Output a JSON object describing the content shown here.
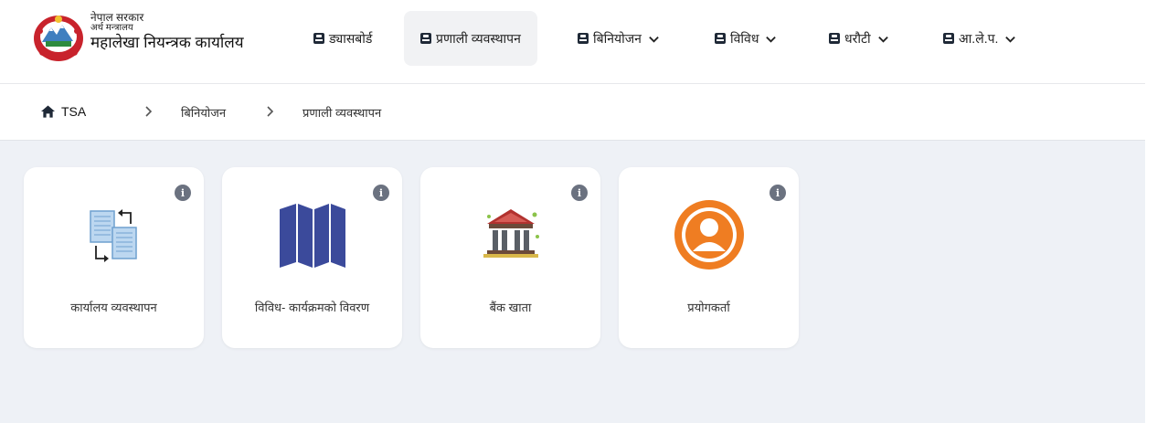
{
  "header": {
    "org_line1": "नेपाल सरकार",
    "org_line2": "अर्थ मन्त्रालय",
    "org_line3": "महालेखा नियन्त्रक कार्यालय",
    "nav": [
      {
        "label": "ड्यासबोर्ड",
        "dropdown": false,
        "active": false
      },
      {
        "label": "प्रणाली व्यवस्थापन",
        "dropdown": false,
        "active": true
      },
      {
        "label": "बिनियोजन",
        "dropdown": true,
        "active": false
      },
      {
        "label": "विविध",
        "dropdown": true,
        "active": false
      },
      {
        "label": "धरौटी",
        "dropdown": true,
        "active": false
      },
      {
        "label": "आ.ले.प.",
        "dropdown": true,
        "active": false
      }
    ]
  },
  "breadcrumb": {
    "home": "TSA",
    "items": [
      "बिनियोजन",
      "प्रणाली व्यवस्थापन"
    ]
  },
  "cards": [
    {
      "label": "कार्यालय व्यवस्थापन",
      "icon": "document-transfer-icon"
    },
    {
      "label": "विविध- कार्यक्रमको विवरण",
      "icon": "map-icon"
    },
    {
      "label": "बैंक खाता",
      "icon": "bank-icon"
    },
    {
      "label": "प्रयोगकर्ता",
      "icon": "user-icon"
    }
  ],
  "colors": {
    "background": "#eef1f6",
    "card": "#ffffff",
    "info_badge": "#6b7280",
    "map_icon": "#3b4a9b",
    "user_icon": "#ef7d22",
    "bank_icon": "#b2322f"
  }
}
